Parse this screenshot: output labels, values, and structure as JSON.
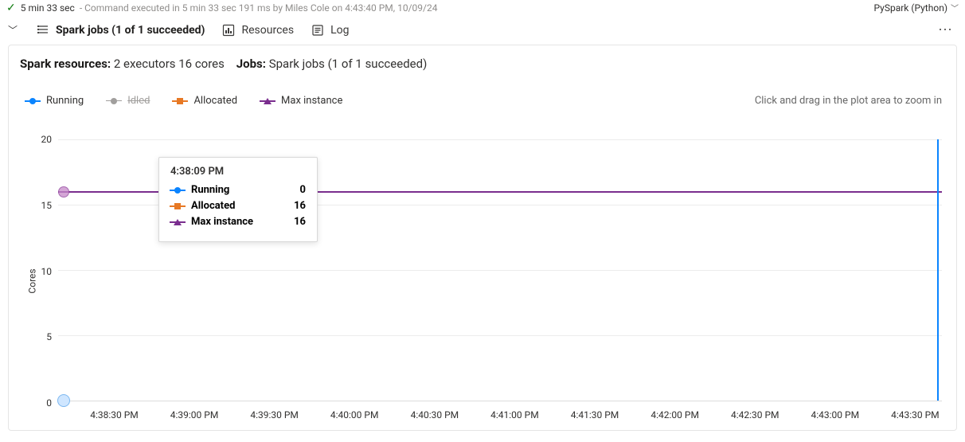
{
  "status": {
    "duration": "5 min 33 sec",
    "detail": "Command executed in 5 min 33 sec 191 ms by Miles Cole on 4:43:40 PM, 10/09/24",
    "language": "PySpark (Python)"
  },
  "tabs": {
    "spark_jobs": "Spark jobs (1 of 1 succeeded)",
    "resources": "Resources",
    "log": "Log"
  },
  "summary": {
    "resources_label": "Spark resources:",
    "resources_value": "2 executors 16 cores",
    "jobs_label": "Jobs:",
    "jobs_value": "Spark jobs (1 of 1 succeeded)"
  },
  "legend": {
    "running": "Running",
    "idled": "Idled",
    "allocated": "Allocated",
    "max_instance": "Max instance",
    "hint": "Click and drag in the plot area to zoom in"
  },
  "tooltip": {
    "time": "4:38:09 PM",
    "running_label": "Running",
    "running_val": "0",
    "allocated_label": "Allocated",
    "allocated_val": "16",
    "max_label": "Max instance",
    "max_val": "16"
  },
  "chart_data": {
    "type": "line",
    "ylabel": "Cores",
    "ylim": [
      0,
      20
    ],
    "y_ticks": [
      0,
      5,
      10,
      15,
      20
    ],
    "x_ticks": [
      "4:38:30 PM",
      "4:39:00 PM",
      "4:39:30 PM",
      "4:40:00 PM",
      "4:40:30 PM",
      "4:41:00 PM",
      "4:41:30 PM",
      "4:42:00 PM",
      "4:42:30 PM",
      "4:43:00 PM",
      "4:43:30 PM"
    ],
    "x_range": [
      "4:38:09 PM",
      "4:43:40 PM"
    ],
    "series": [
      {
        "name": "Running",
        "color": "#1e90ff",
        "values": [
          0,
          0
        ]
      },
      {
        "name": "Idled",
        "color": "#999999",
        "visible": false
      },
      {
        "name": "Allocated",
        "color": "#e77925",
        "values": [
          16,
          16
        ]
      },
      {
        "name": "Max instance",
        "color": "#7a2e8e",
        "values": [
          16,
          16
        ]
      }
    ],
    "hover_point": {
      "time": "4:38:09 PM",
      "Running": 0,
      "Allocated": 16,
      "Max instance": 16
    },
    "cursor_time": "4:43:40 PM"
  }
}
